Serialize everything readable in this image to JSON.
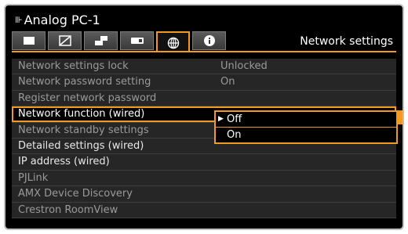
{
  "header": {
    "title": "Analog PC-1",
    "source_icon": "input-source-icon"
  },
  "tabs": [
    {
      "icon": "picture-adjustment-icon"
    },
    {
      "icon": "screen-settings-icon"
    },
    {
      "icon": "install-settings-icon"
    },
    {
      "icon": "system-settings-icon"
    },
    {
      "icon": "network-globe-icon",
      "active": true
    },
    {
      "icon": "information-icon"
    }
  ],
  "menu_title": "Network settings",
  "items": [
    {
      "label": "Network settings lock",
      "value": "Unlocked"
    },
    {
      "label": "Network password setting",
      "value": "On"
    },
    {
      "label": "Register network password",
      "value": ""
    },
    {
      "label": "Network function (wired)",
      "value": ""
    },
    {
      "label": "Network standby settings",
      "value": ""
    },
    {
      "label": "Detailed settings (wired)",
      "value": ""
    },
    {
      "label": "IP address (wired)",
      "value": ""
    },
    {
      "label": "PJLink",
      "value": ""
    },
    {
      "label": "AMX Device Discovery",
      "value": ""
    },
    {
      "label": "Crestron RoomView",
      "value": ""
    }
  ],
  "dropdown": {
    "options": [
      "Off",
      "On"
    ],
    "selected": "Off",
    "marker": "▶"
  },
  "colors": {
    "accent": "#f39a1e",
    "text_dim": "#9a9a9a",
    "text_bright": "#ffffff",
    "row_bg": "#262626"
  }
}
